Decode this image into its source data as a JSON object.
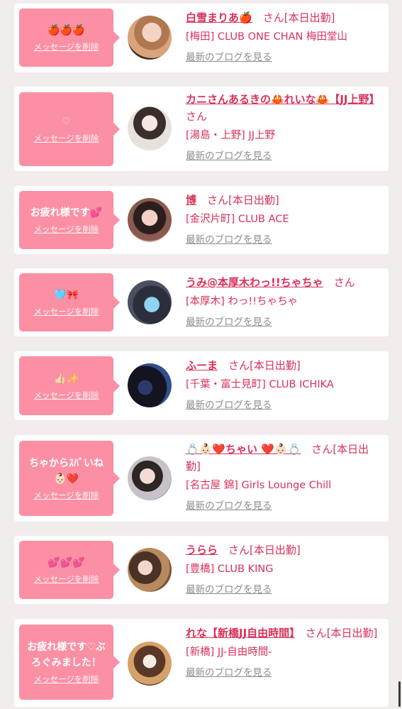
{
  "common": {
    "delete_label": "メッセージを削除",
    "san_label": "さん",
    "blog_label": "最新のブログを見る"
  },
  "items": [
    {
      "message": "🍎🍎🍎",
      "name": "白雪まりあ🍎",
      "status": "[本日出勤]",
      "shop": "[梅田] CLUB ONE CHAN 梅田堂山"
    },
    {
      "message": "♡",
      "name": "カニさんあるきの🦀れいな🦀【JJ上野】",
      "status": "",
      "shop": "[湯島・上野] JJ上野"
    },
    {
      "message": "お疲れ様です💕",
      "name": "博",
      "status": "[本日出勤]",
      "shop": "[金沢片町] CLUB ACE"
    },
    {
      "message": "🩵🎀",
      "name": "うみ@本厚木わっ!!ちゃちゃ",
      "status": "",
      "shop": "[本厚木] わっ!!ちゃちゃ"
    },
    {
      "message": "👍🏻✨",
      "name": "ふーま",
      "status": "[本日出勤]",
      "shop": "[千葉・富士見町] CLUB ICHIKA"
    },
    {
      "message": "ちゃからｽﾊﾞいね👶🏻❤️",
      "name": "💍👶🏻❤️ちゃい ❤️👶🏻💍",
      "status": "[本日出勤]",
      "shop": "[名古屋 錦] Girls Lounge Chill"
    },
    {
      "message": "💕💕💕",
      "name": "うらら",
      "status": "[本日出勤]",
      "shop": "[豊橋] CLUB KING"
    },
    {
      "message": "お疲れ様です♡ぶろぐみました！",
      "name": "れな【新橋JJ自由時間】",
      "status": "[本日出勤]",
      "shop": "[新橋] JJ-自由時間-"
    }
  ],
  "colors": {
    "accent": "#d9315a",
    "bubble": "#fb90a5",
    "background": "#f1eded"
  }
}
